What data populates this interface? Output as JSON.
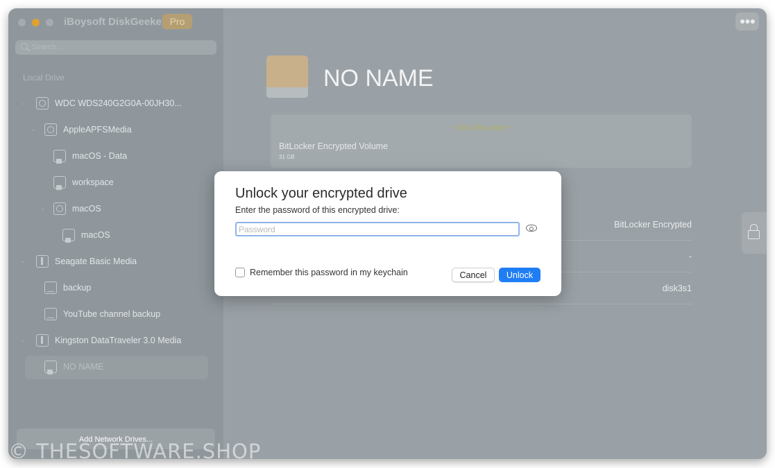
{
  "app": {
    "title": "iBoysoft DiskGeeker",
    "badge": "Pro"
  },
  "sidebar": {
    "search_placeholder": "Search...",
    "section_label": "Local Drive",
    "items": [
      {
        "label": "WDC WDS240G2G0A-00JH30...",
        "icon": "disk-icon"
      },
      {
        "label": "AppleAPFSMedia",
        "icon": "disk-icon"
      },
      {
        "label": "macOS - Data",
        "icon": "locked-volume-icon"
      },
      {
        "label": "workspace",
        "icon": "locked-volume-icon"
      },
      {
        "label": "macOS",
        "icon": "disk-icon"
      },
      {
        "label": "macOS",
        "icon": "locked-volume-icon"
      },
      {
        "label": "Seagate Basic Media",
        "icon": "usb-icon"
      },
      {
        "label": "backup",
        "icon": "volume-icon"
      },
      {
        "label": "YouTube channel backup",
        "icon": "volume-icon"
      },
      {
        "label": "Kingston DataTraveler 3.0 Media",
        "icon": "usb-icon"
      },
      {
        "label": "NO NAME",
        "icon": "locked-volume-icon"
      }
    ],
    "add_network": "Add Network Drives..."
  },
  "main": {
    "drive_name": "NO NAME",
    "status": "• Not Mounted •",
    "volume_type": "BitLocker Encrypted Volume",
    "volume_size": "31 GB",
    "props": [
      "BitLocker Encrypted",
      "-",
      "disk3s1"
    ]
  },
  "dialog": {
    "title": "Unlock your encrypted drive",
    "subtitle": "Enter the password of this encrypted drive:",
    "password_placeholder": "Password",
    "remember_label": "Remember this password in my keychain",
    "cancel_label": "Cancel",
    "unlock_label": "Unlock"
  },
  "watermark": "© THESOFTWARE.SHOP",
  "colors": {
    "accent": "#1f7ef4",
    "pro_badge": "#b59f72",
    "not_mounted": "#b2b068"
  }
}
